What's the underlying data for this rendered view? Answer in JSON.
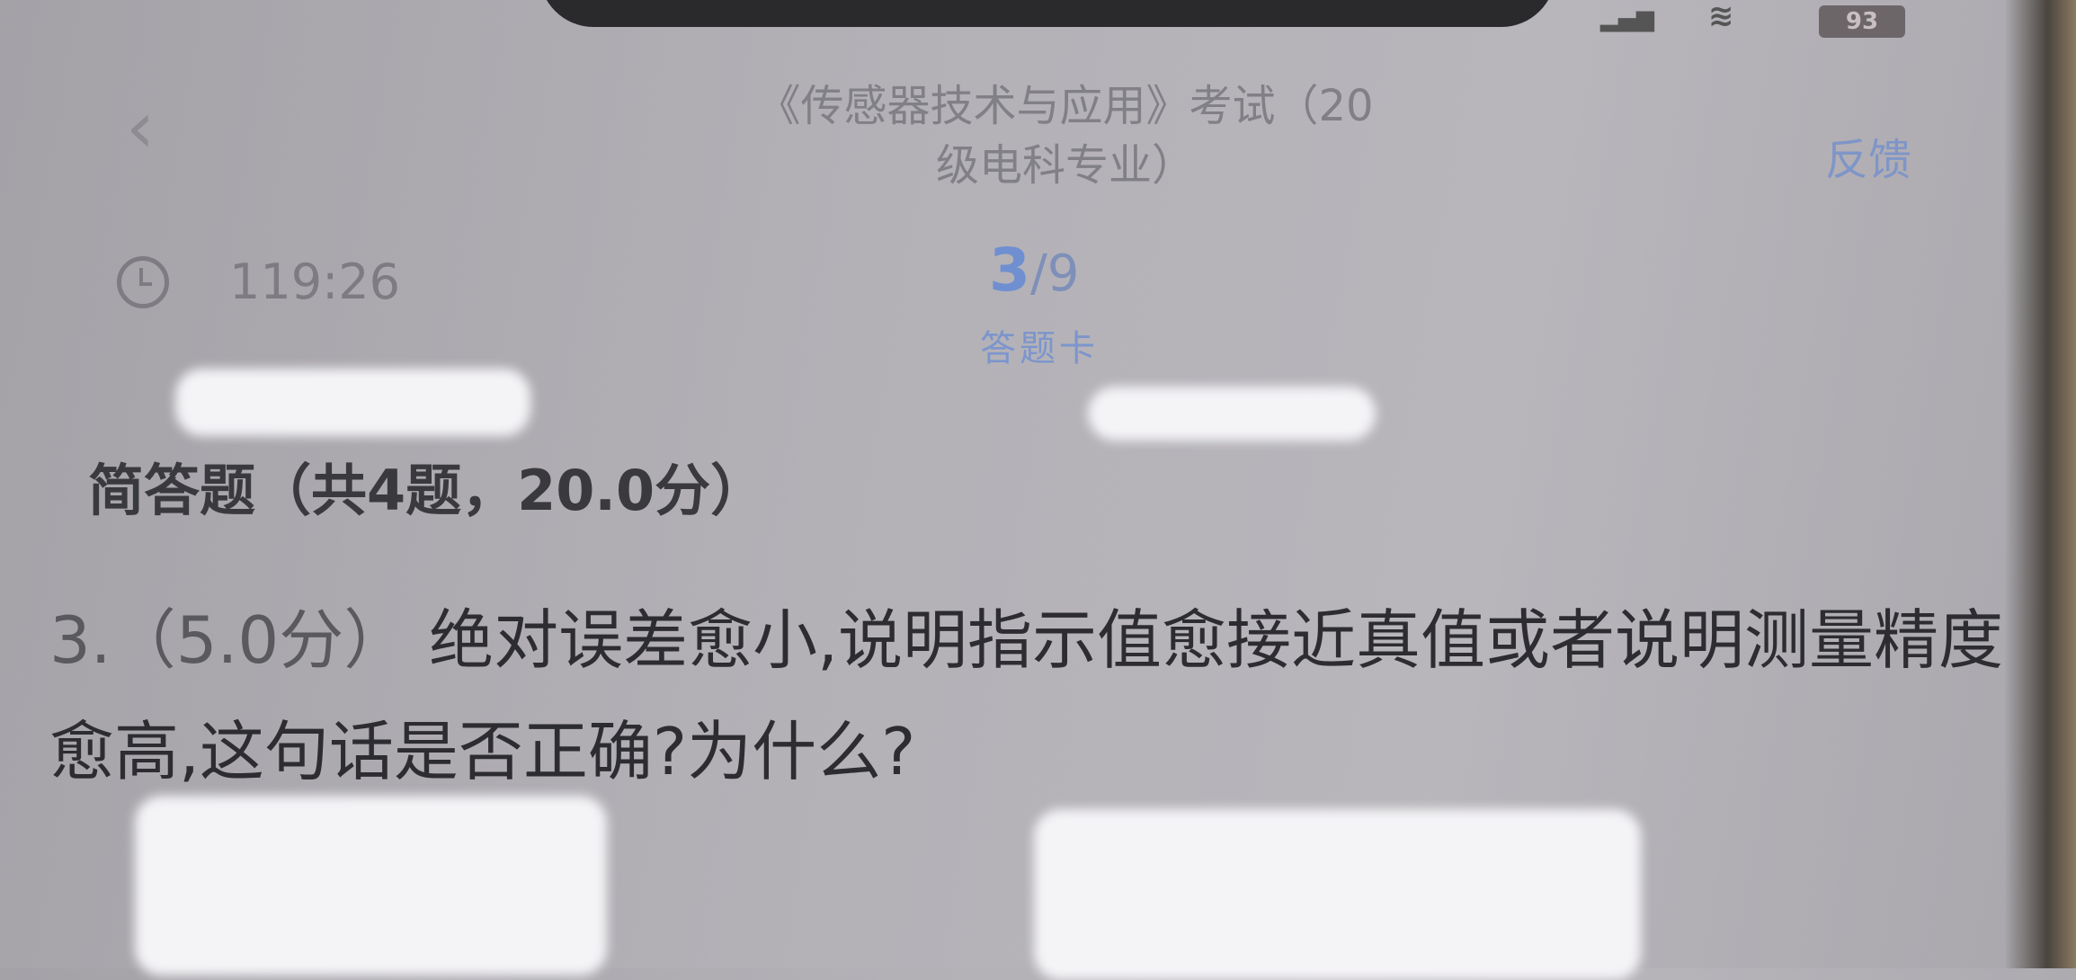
{
  "status_bar": {
    "signal_icon": "signal-icon",
    "wifi_icon": "wifi-icon",
    "battery": "93"
  },
  "header": {
    "back_icon": "chevron-left-icon",
    "title": "《传感器技术与应用》考试（20级电科专业）",
    "title_line1": "《传感器技术与应用》考试（20",
    "title_line2": "级电科专业）",
    "feedback_label": "反馈"
  },
  "exam_bar": {
    "clock_icon": "clock-icon",
    "timer": "119:26",
    "current_question": "3",
    "total_questions": "/9",
    "answer_card_label": "答题卡",
    "accent_color": "#6f8fd0"
  },
  "section": {
    "heading": "简答题（共4题，20.0分）"
  },
  "question": {
    "number": "3.（5.0分）",
    "text": "绝对误差愈小,说明指示值愈接近真值或者说明测量精度愈高,这句话是否正确?为什么?"
  }
}
